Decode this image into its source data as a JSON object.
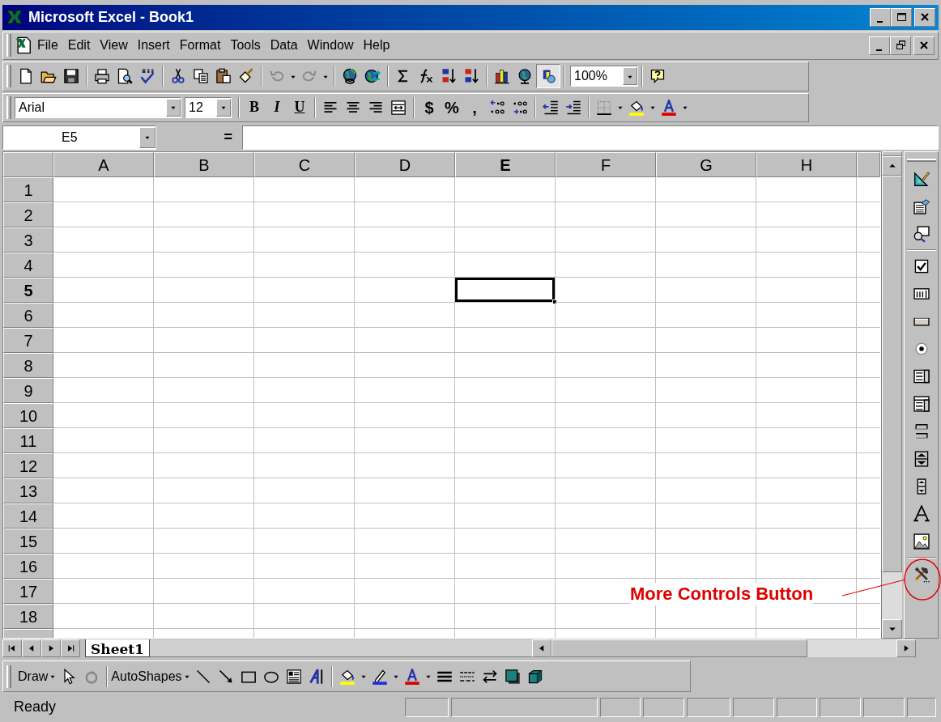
{
  "window": {
    "title": "Microsoft Excel - Book1",
    "controls": [
      {
        "kind": "minimize"
      },
      {
        "kind": "maximize"
      },
      {
        "kind": "close"
      }
    ]
  },
  "workbook_controls": [
    {
      "kind": "minimize"
    },
    {
      "kind": "restore"
    },
    {
      "kind": "close"
    }
  ],
  "menu": [
    {
      "label": "File"
    },
    {
      "label": "Edit"
    },
    {
      "label": "View"
    },
    {
      "label": "Insert"
    },
    {
      "label": "Format"
    },
    {
      "label": "Tools"
    },
    {
      "label": "Data"
    },
    {
      "label": "Window"
    },
    {
      "label": "Help"
    }
  ],
  "standard_toolbar": {
    "zoom": "100%",
    "toolbox_pressed": true
  },
  "formatting_toolbar": {
    "font": "Arial",
    "size": "12",
    "style_buttons": [
      "B",
      "I",
      "U"
    ],
    "number_buttons": [
      "$",
      "%",
      ","
    ]
  },
  "formula_bar": {
    "name_box": "E5",
    "equals": "="
  },
  "columns": [
    {
      "label": "A",
      "selected": false
    },
    {
      "label": "B",
      "selected": false
    },
    {
      "label": "C",
      "selected": false
    },
    {
      "label": "D",
      "selected": false
    },
    {
      "label": "E",
      "selected": true
    },
    {
      "label": "F",
      "selected": false
    },
    {
      "label": "G",
      "selected": false
    },
    {
      "label": "H",
      "selected": false
    }
  ],
  "rows": [
    {
      "label": "1",
      "selected": false
    },
    {
      "label": "2",
      "selected": false
    },
    {
      "label": "3",
      "selected": false
    },
    {
      "label": "4",
      "selected": false
    },
    {
      "label": "5",
      "selected": true
    },
    {
      "label": "6",
      "selected": false
    },
    {
      "label": "7",
      "selected": false
    },
    {
      "label": "8",
      "selected": false
    },
    {
      "label": "9",
      "selected": false
    },
    {
      "label": "10",
      "selected": false
    },
    {
      "label": "11",
      "selected": false
    },
    {
      "label": "12",
      "selected": false
    },
    {
      "label": "13",
      "selected": false
    },
    {
      "label": "14",
      "selected": false
    },
    {
      "label": "15",
      "selected": false
    },
    {
      "label": "16",
      "selected": false
    },
    {
      "label": "17",
      "selected": false
    },
    {
      "label": "18",
      "selected": false
    }
  ],
  "sheet_tabs": [
    {
      "label": "Sheet1",
      "selected": true
    }
  ],
  "drawing_toolbar": {
    "draw": "Draw",
    "autoshapes": "AutoShapes"
  },
  "status_bar": {
    "text": "Ready"
  },
  "annotation": {
    "text": "More Controls Button"
  }
}
